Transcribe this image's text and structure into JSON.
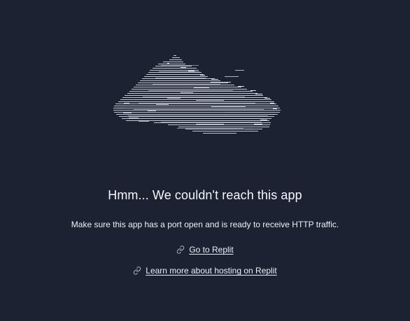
{
  "page": {
    "title": "Hmm... We couldn't reach this app",
    "subtitle": "Make sure this app has a port open and is ready to receive HTTP traffic."
  },
  "links": [
    {
      "label": "Go to Replit",
      "icon": "link-icon"
    },
    {
      "label": "Learn more about hosting on Replit",
      "icon": "link-icon"
    }
  ],
  "theme": {
    "background": "#1c2232",
    "text": "#f3f4f6",
    "cloud": "#d5d9e2"
  },
  "illustration": {
    "icon": "ascii-cloud-icon"
  }
}
